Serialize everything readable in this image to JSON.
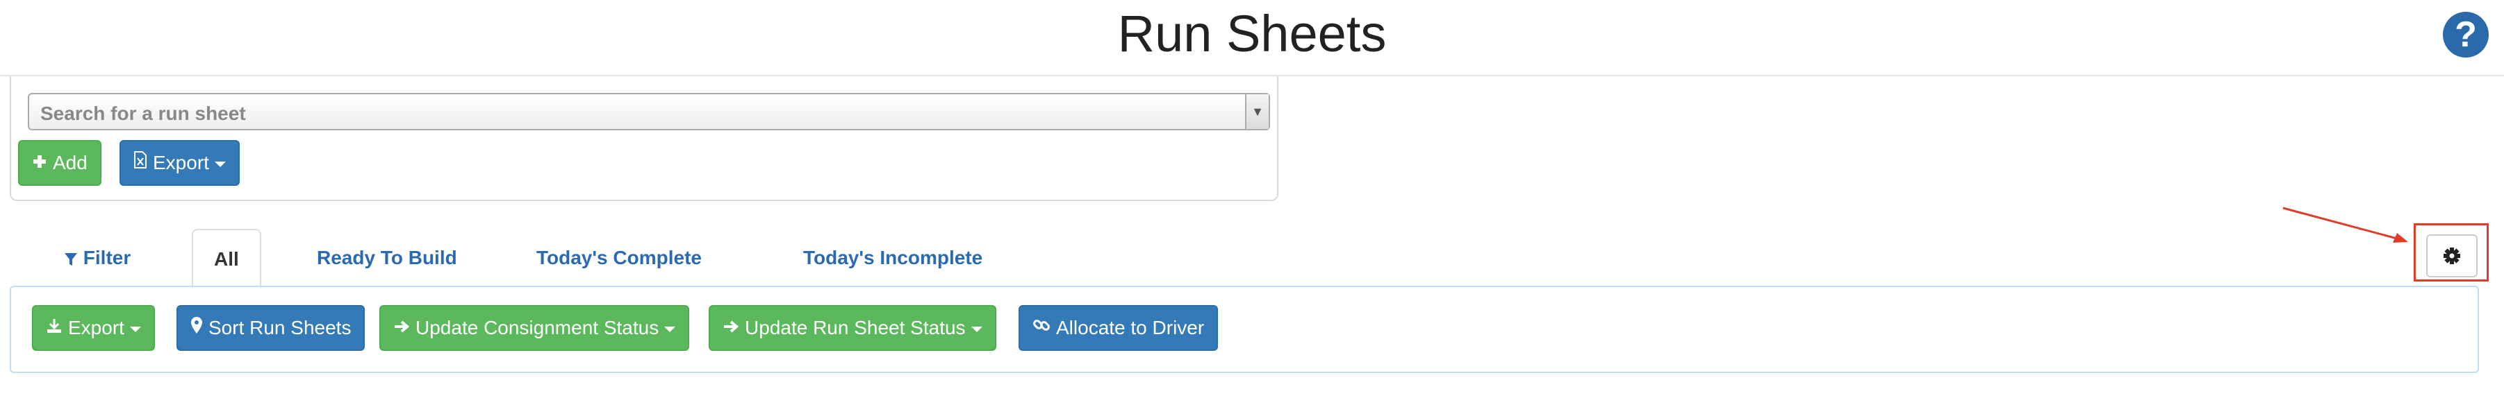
{
  "page": {
    "title": "Run Sheets",
    "help_icon": "question-circle-icon"
  },
  "search": {
    "placeholder": "Search for a run sheet"
  },
  "toolbar": {
    "add_label": "Add",
    "export_label": "Export"
  },
  "tabs": [
    {
      "label": "Filter",
      "icon": "filter-icon"
    },
    {
      "label": "All",
      "active": true
    },
    {
      "label": "Ready To Build"
    },
    {
      "label": "Today's Complete"
    },
    {
      "label": "Today's Incomplete"
    }
  ],
  "actions": {
    "export_label": "Export",
    "sort_label": "Sort Run Sheets",
    "update_consignment_label": "Update Consignment Status",
    "update_run_sheet_label": "Update Run Sheet Status",
    "allocate_driver_label": "Allocate to Driver"
  },
  "settings": {
    "icon": "gear-icon",
    "highlighted": true
  },
  "colors": {
    "green": "#5cb85c",
    "blue": "#337ab7",
    "link": "#2a6ab0",
    "annotation_red": "#e03b24"
  }
}
